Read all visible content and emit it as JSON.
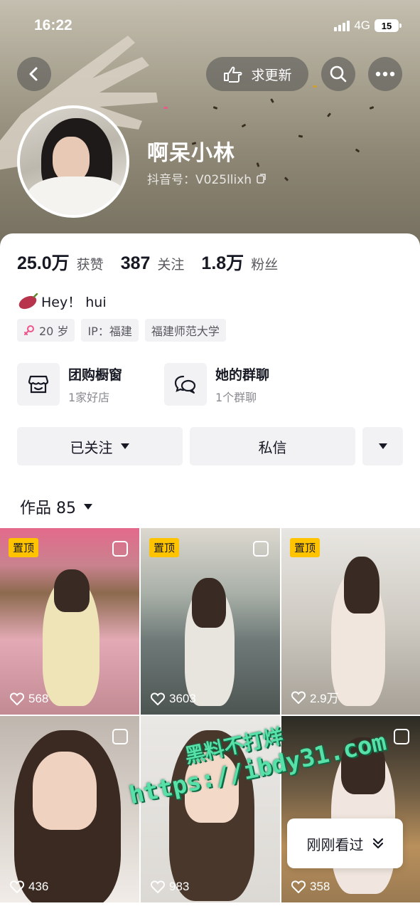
{
  "status_bar": {
    "time": "16:22",
    "network": "4G",
    "battery": "15"
  },
  "header": {
    "update_button": "求更新",
    "name": "啊呆小林",
    "douyin_id": "抖音号：V025llixh"
  },
  "stats": [
    {
      "value": "25.0万",
      "label": "获赞"
    },
    {
      "value": "387",
      "label": "关注"
    },
    {
      "value": "1.8万",
      "label": "粉丝"
    }
  ],
  "bio": "Hey！ hui",
  "tags": {
    "age": "20 岁",
    "ip": "IP：福建",
    "school": "福建师范大学"
  },
  "features": [
    {
      "title": "团购橱窗",
      "subtitle": "1家好店"
    },
    {
      "title": "她的群聊",
      "subtitle": "1个群聊"
    }
  ],
  "actions": {
    "follow": "已关注",
    "message": "私信"
  },
  "works_tab": "作品 85",
  "grid": [
    {
      "pinned": "置顶",
      "likes": "568",
      "bg": "#d9a7b0"
    },
    {
      "pinned": "置顶",
      "likes": "3603",
      "bg": "#9aa3a6"
    },
    {
      "pinned": "置顶",
      "likes": "2.9万",
      "bg": "#d6d2ca"
    },
    {
      "pinned": "",
      "likes": "436",
      "bg": "#c9c2bc"
    },
    {
      "pinned": "",
      "likes": "983",
      "bg": "#e3e0dc"
    },
    {
      "pinned": "",
      "likes": "358",
      "bg": "#7a6a55"
    }
  ],
  "watermark": {
    "line1": "黑料不打烊",
    "line2": "https://ibdy31.com"
  },
  "recent_button": "刚刚看过"
}
